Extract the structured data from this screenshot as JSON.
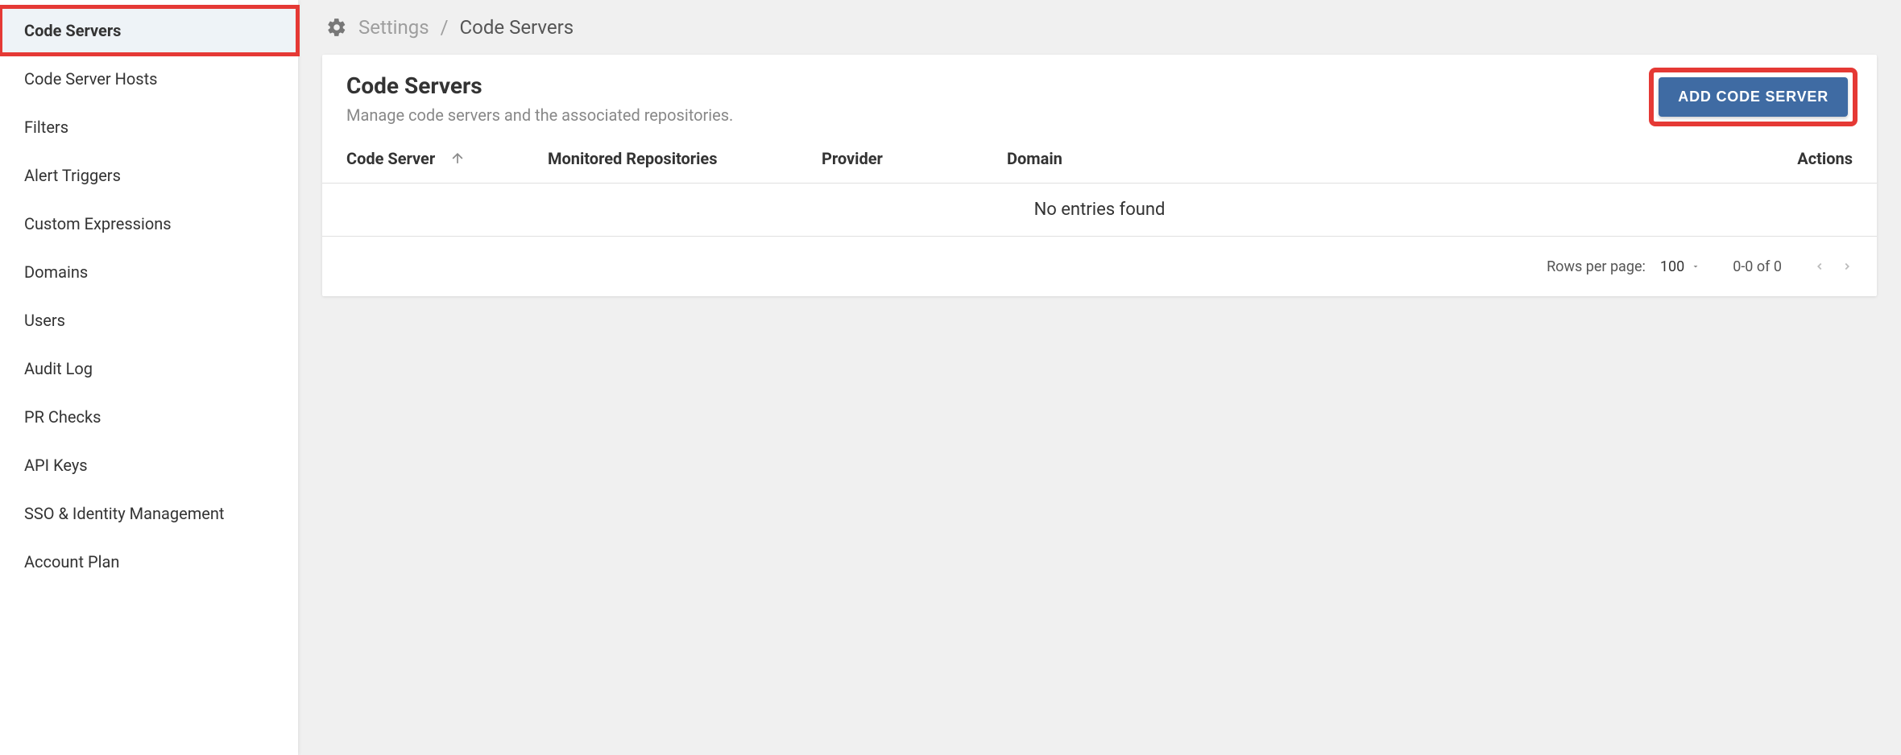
{
  "sidebar": {
    "items": [
      {
        "label": "Code Servers",
        "active": true,
        "highlighted": true
      },
      {
        "label": "Code Server Hosts"
      },
      {
        "label": "Filters"
      },
      {
        "label": "Alert Triggers"
      },
      {
        "label": "Custom Expressions"
      },
      {
        "label": "Domains"
      },
      {
        "label": "Users"
      },
      {
        "label": "Audit Log"
      },
      {
        "label": "PR Checks"
      },
      {
        "label": "API Keys"
      },
      {
        "label": "SSO & Identity Management"
      },
      {
        "label": "Account Plan"
      }
    ]
  },
  "breadcrumb": {
    "root": "Settings",
    "separator": "/",
    "current": "Code Servers"
  },
  "page": {
    "title": "Code Servers",
    "subtitle": "Manage code servers and the associated repositories.",
    "add_button_label": "ADD CODE SERVER"
  },
  "table": {
    "columns": {
      "code_server": "Code Server",
      "monitored": "Monitored Repositories",
      "provider": "Provider",
      "domain": "Domain",
      "actions": "Actions"
    },
    "sort_direction": "asc",
    "empty_message": "No entries found"
  },
  "pagination": {
    "rows_per_page_label": "Rows per page:",
    "rows_per_page_value": "100",
    "range": "0-0 of 0"
  }
}
